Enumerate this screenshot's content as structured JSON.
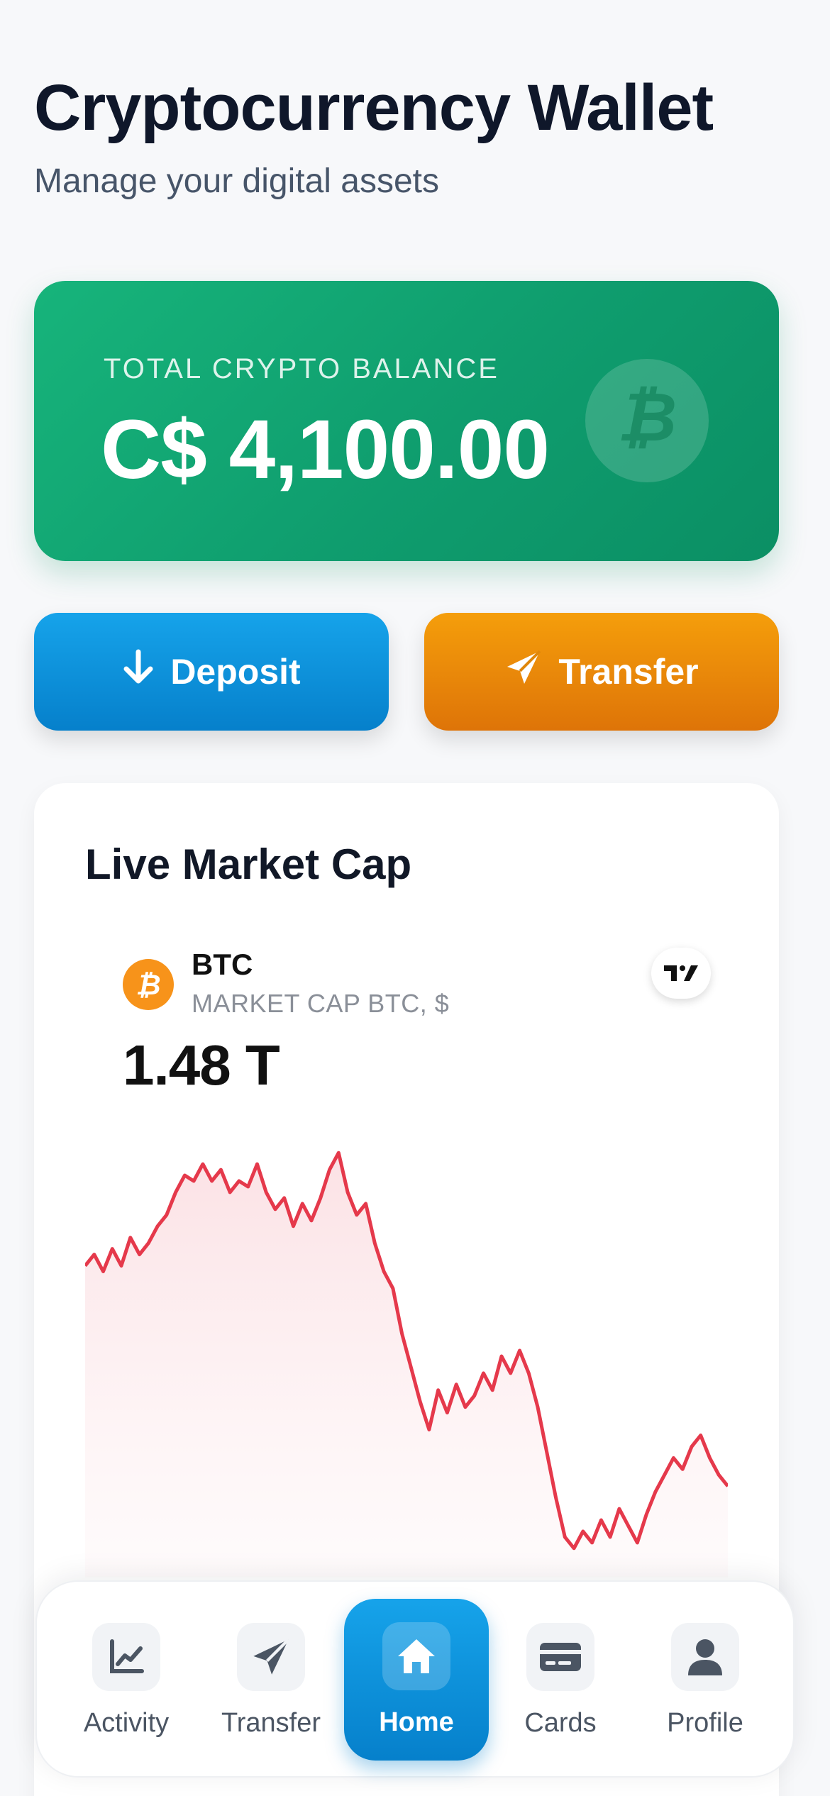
{
  "header": {
    "title": "Cryptocurrency Wallet",
    "subtitle": "Manage your digital assets"
  },
  "balance": {
    "label": "TOTAL CRYPTO BALANCE",
    "value": "C$ 4,100.00",
    "icon": "bitcoin-icon"
  },
  "actions": {
    "deposit_label": "Deposit",
    "deposit_icon": "arrow-down-icon",
    "transfer_label": "Transfer",
    "transfer_icon": "paper-plane-icon"
  },
  "market": {
    "title": "Live Market Cap",
    "widget": {
      "symbol": "BTC",
      "subtitle": "MARKET CAP BTC, $",
      "value": "1.48 T",
      "provider_logo": "tradingview-logo",
      "line_color": "#e5394b"
    }
  },
  "chart_data": {
    "type": "area",
    "title": "",
    "series": [
      {
        "values": [
          1.31,
          1.33,
          1.3,
          1.34,
          1.31,
          1.36,
          1.33,
          1.35,
          1.38,
          1.4,
          1.44,
          1.47,
          1.46,
          1.49,
          1.46,
          1.48,
          1.44,
          1.46,
          1.45,
          1.49,
          1.44,
          1.41,
          1.43,
          1.38,
          1.42,
          1.39,
          1.43,
          1.48,
          1.51,
          1.44,
          1.4,
          1.42,
          1.35,
          1.3,
          1.27,
          1.19,
          1.13,
          1.07,
          1.02,
          1.09,
          1.05,
          1.1,
          1.06,
          1.08,
          1.12,
          1.09,
          1.15,
          1.12,
          1.16,
          1.12,
          1.06,
          0.98,
          0.9,
          0.83,
          0.81,
          0.84,
          0.82,
          0.86,
          0.83,
          0.88,
          0.85,
          0.82,
          0.87,
          0.91,
          0.94,
          0.97,
          0.95,
          0.99,
          1.01,
          0.97,
          0.94,
          0.92
        ]
      }
    ]
  },
  "nav": {
    "items": [
      {
        "label": "Activity",
        "icon": "chart-line-icon"
      },
      {
        "label": "Transfer",
        "icon": "paper-plane-icon"
      },
      {
        "label": "Home",
        "icon": "home-icon"
      },
      {
        "label": "Cards",
        "icon": "credit-card-icon"
      },
      {
        "label": "Profile",
        "icon": "user-icon"
      }
    ],
    "active": "Home"
  }
}
